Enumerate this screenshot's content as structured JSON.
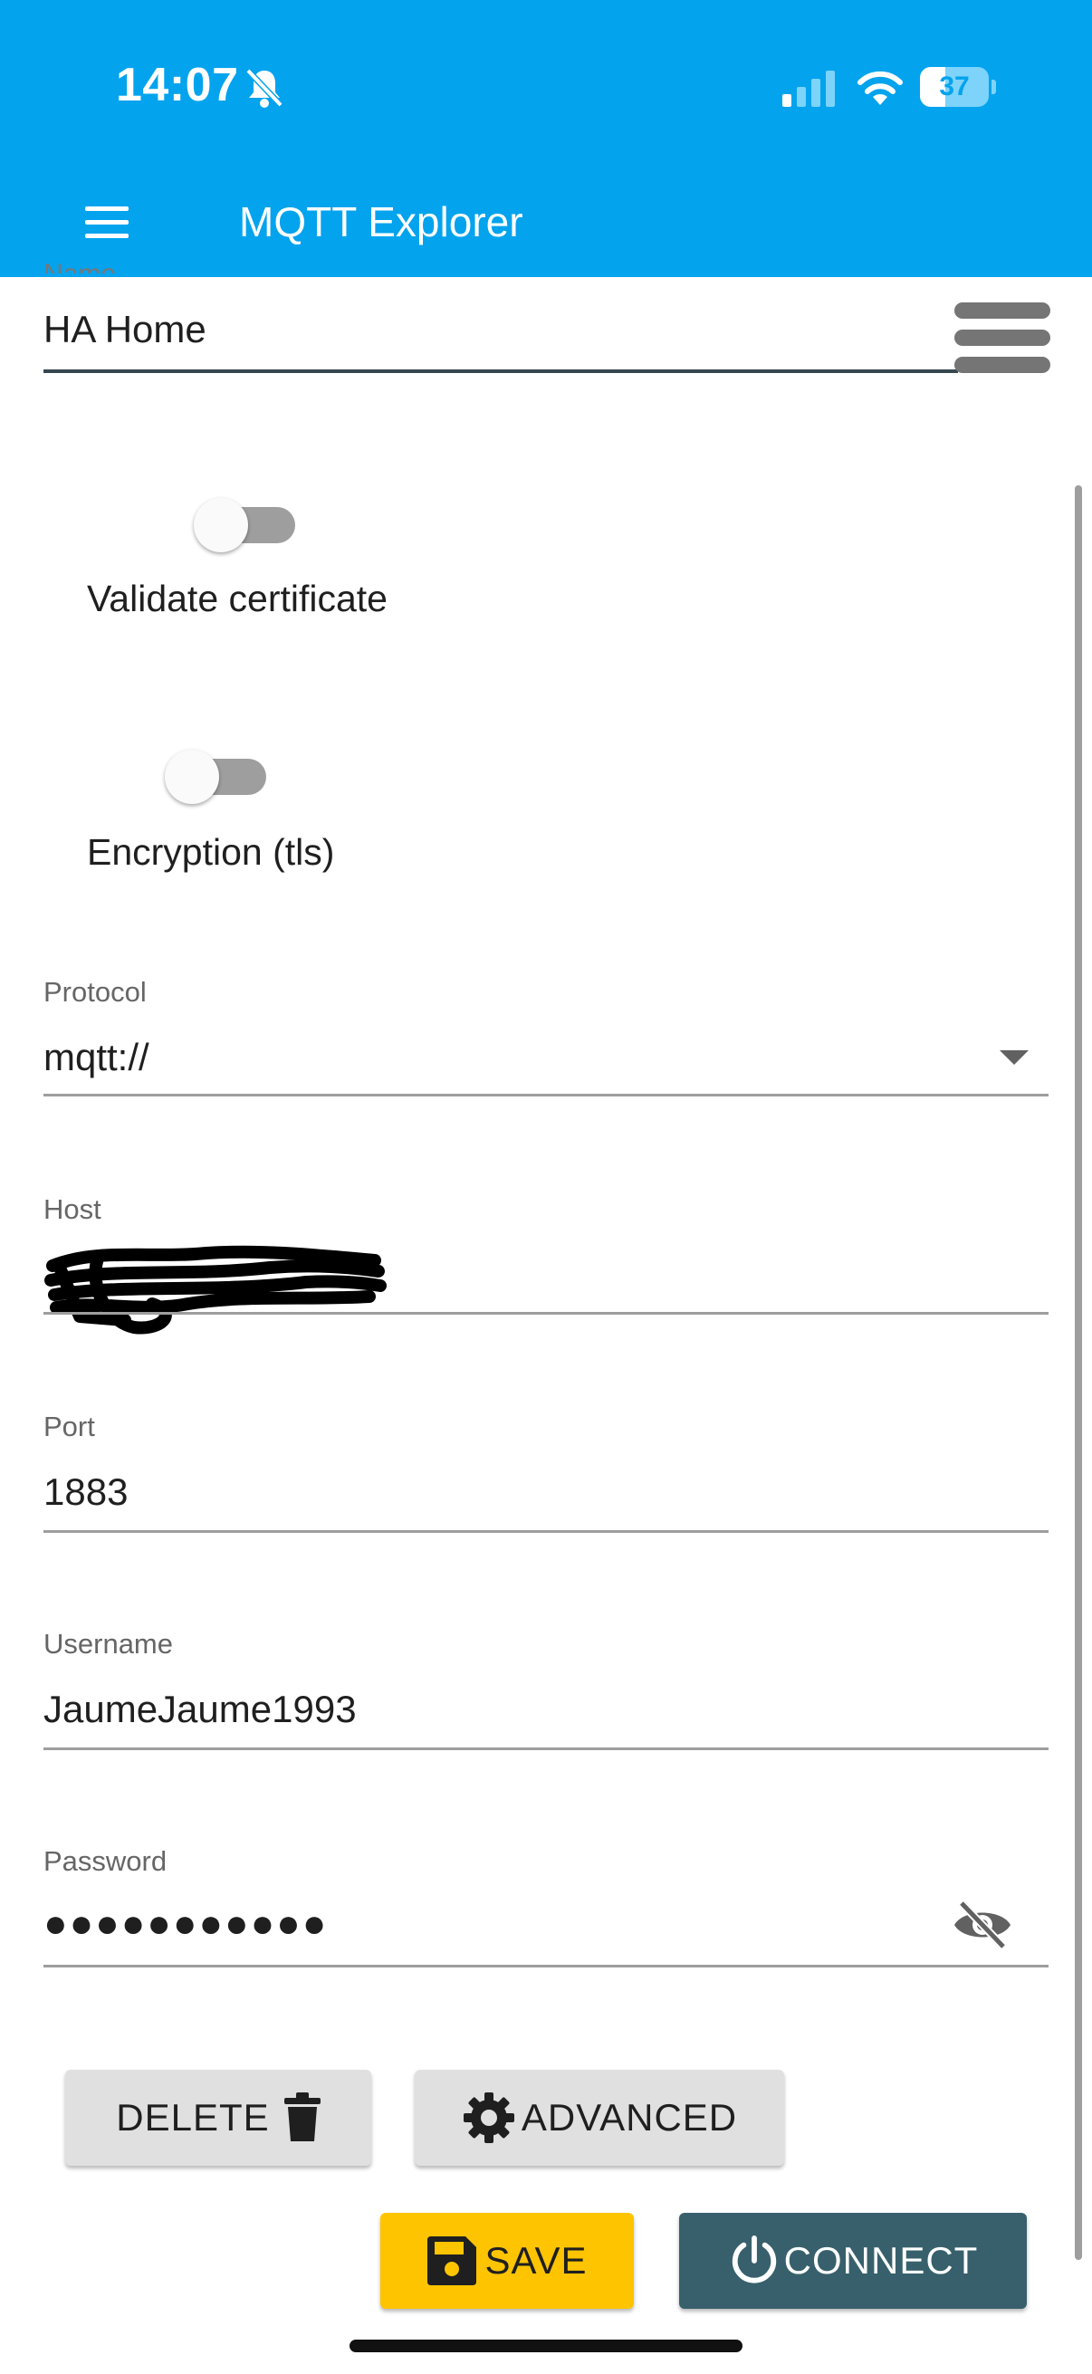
{
  "status_bar": {
    "time": "14:07",
    "battery": "37",
    "battery_level": 0.37,
    "icons": [
      "bell-slash-icon",
      "cellular-signal-icon",
      "wifi-icon",
      "battery-icon"
    ]
  },
  "header": {
    "title": "MQTT Explorer",
    "menu_icon": "hamburger-menu-icon",
    "background": "#03a3ee"
  },
  "connection_form": {
    "name": {
      "label": "Name",
      "value": "HA Home"
    },
    "validate_certificate": {
      "label": "Validate certificate",
      "checked": false
    },
    "encryption": {
      "label": "Encryption (tls)",
      "checked": false
    },
    "protocol": {
      "label": "Protocol",
      "value": "mqtt://"
    },
    "host": {
      "label": "Host",
      "value": ""
    },
    "port": {
      "label": "Port",
      "value": "1883"
    },
    "username": {
      "label": "Username",
      "value": "JaumeJaume1993"
    },
    "password": {
      "label": "Password",
      "value": "●●●●●●●●●●●",
      "visibility_icon": "eye-off-icon"
    }
  },
  "actions": {
    "delete_label": "DELETE",
    "advanced_label": "ADVANCED",
    "save_label": "SAVE",
    "connect_label": "CONNECT"
  },
  "colors": {
    "accent": "#03a3ee",
    "save": "#ffc400",
    "connect": "#37606c",
    "grey_button": "#e0e0e0"
  }
}
